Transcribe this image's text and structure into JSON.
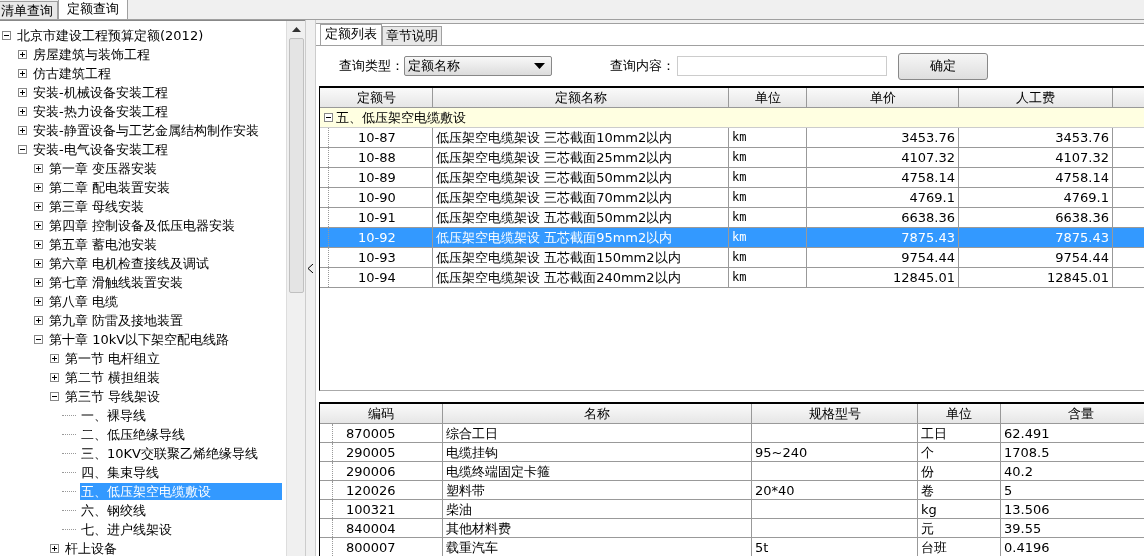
{
  "top_tabs": [
    {
      "label": "清单查询",
      "selected": false
    },
    {
      "label": "定额查询",
      "selected": true
    }
  ],
  "tree": [
    {
      "label": "北京市建设工程预算定额(2012)",
      "expanded": true,
      "selected": false,
      "children": [
        {
          "label": "房屋建筑与装饰工程",
          "expanded": false,
          "selected": false
        },
        {
          "label": "仿古建筑工程",
          "expanded": false,
          "selected": false
        },
        {
          "label": "安装-机械设备安装工程",
          "expanded": false,
          "selected": false
        },
        {
          "label": "安装-热力设备安装工程",
          "expanded": false,
          "selected": false
        },
        {
          "label": "安装-静置设备与工艺金属结构制作安装",
          "expanded": false,
          "selected": false
        },
        {
          "label": "安装-电气设备安装工程",
          "expanded": true,
          "selected": false,
          "children": [
            {
              "label": "第一章 变压器安装",
              "expanded": false,
              "selected": false
            },
            {
              "label": "第二章 配电装置安装",
              "expanded": false,
              "selected": false
            },
            {
              "label": "第三章 母线安装",
              "expanded": false,
              "selected": false
            },
            {
              "label": "第四章 控制设备及低压电器安装",
              "expanded": false,
              "selected": false
            },
            {
              "label": "第五章 蓄电池安装",
              "expanded": false,
              "selected": false
            },
            {
              "label": "第六章 电机检查接线及调试",
              "expanded": false,
              "selected": false
            },
            {
              "label": "第七章 滑触线装置安装",
              "expanded": false,
              "selected": false
            },
            {
              "label": "第八章 电缆",
              "expanded": false,
              "selected": false
            },
            {
              "label": "第九章 防雷及接地装置",
              "expanded": false,
              "selected": false
            },
            {
              "label": "第十章 10kV以下架空配电线路",
              "expanded": true,
              "selected": false,
              "children": [
                {
                  "label": "第一节 电杆组立",
                  "expanded": false,
                  "selected": false
                },
                {
                  "label": "第二节 横担组装",
                  "expanded": false,
                  "selected": false
                },
                {
                  "label": "第三节 导线架设",
                  "expanded": true,
                  "selected": false,
                  "children": [
                    {
                      "label": "一、裸导线",
                      "selected": false
                    },
                    {
                      "label": "二、低压绝缘导线",
                      "selected": false
                    },
                    {
                      "label": "三、10KV交联聚乙烯绝缘导线",
                      "selected": false
                    },
                    {
                      "label": "四、集束导线",
                      "selected": false
                    },
                    {
                      "label": "五、低压架空电缆敷设",
                      "selected": true
                    },
                    {
                      "label": "六、钢绞线",
                      "selected": false
                    },
                    {
                      "label": "七、进户线架设",
                      "selected": false
                    }
                  ]
                },
                {
                  "label": "杆上设备",
                  "expanded": false,
                  "selected": false
                }
              ]
            }
          ]
        }
      ]
    }
  ],
  "right_tabs": [
    {
      "label": "定额列表",
      "selected": true
    },
    {
      "label": "章节说明",
      "selected": false
    }
  ],
  "query": {
    "type_label": "查询类型：",
    "type_value": "定额名称",
    "content_label": "查询内容：",
    "button": "确定"
  },
  "quota_table": {
    "columns": [
      "定额号",
      "定额名称",
      "单位",
      "单价",
      "人工费"
    ],
    "group": {
      "label": "五、低压架空电缆敷设",
      "expanded": true
    },
    "rows": [
      {
        "code": "10-87",
        "name": "低压架空电缆架设 三芯截面10mm2以内",
        "unit": "km",
        "price": "3453.76",
        "labor": "3453.76",
        "selected": false
      },
      {
        "code": "10-88",
        "name": "低压架空电缆架设 三芯截面25mm2以内",
        "unit": "km",
        "price": "4107.32",
        "labor": "4107.32",
        "selected": false
      },
      {
        "code": "10-89",
        "name": "低压架空电缆架设 三芯截面50mm2以内",
        "unit": "km",
        "price": "4758.14",
        "labor": "4758.14",
        "selected": false
      },
      {
        "code": "10-90",
        "name": "低压架空电缆架设 三芯截面70mm2以内",
        "unit": "km",
        "price": "4769.1",
        "labor": "4769.1",
        "selected": false
      },
      {
        "code": "10-91",
        "name": "低压架空电缆架设 五芯截面50mm2以内",
        "unit": "km",
        "price": "6638.36",
        "labor": "6638.36",
        "selected": false
      },
      {
        "code": "10-92",
        "name": "低压架空电缆架设 五芯截面95mm2以内",
        "unit": "km",
        "price": "7875.43",
        "labor": "7875.43",
        "selected": true
      },
      {
        "code": "10-93",
        "name": "低压架空电缆架设 五芯截面150mm2以内",
        "unit": "km",
        "price": "9754.44",
        "labor": "9754.44",
        "selected": false
      },
      {
        "code": "10-94",
        "name": "低压架空电缆架设 五芯截面240mm2以内",
        "unit": "km",
        "price": "12845.01",
        "labor": "12845.01",
        "selected": false
      }
    ]
  },
  "resource_table": {
    "columns": [
      "编码",
      "名称",
      "规格型号",
      "单位",
      "含量"
    ],
    "rows": [
      [
        "870005",
        "综合工日",
        "",
        "工日",
        "62.491"
      ],
      [
        "290005",
        "电缆挂钩",
        "95~240",
        "个",
        "1708.5"
      ],
      [
        "290006",
        "电缆终端固定卡箍",
        "",
        "份",
        "40.2"
      ],
      [
        "120026",
        "塑料带",
        "20*40",
        "卷",
        "5"
      ],
      [
        "100321",
        "柴油",
        "",
        "kg",
        "13.506"
      ],
      [
        "840004",
        "其他材料费",
        "",
        "元",
        "39.55"
      ],
      [
        "800007",
        "载重汽车",
        "5t",
        "台班",
        "0.4196"
      ]
    ]
  }
}
